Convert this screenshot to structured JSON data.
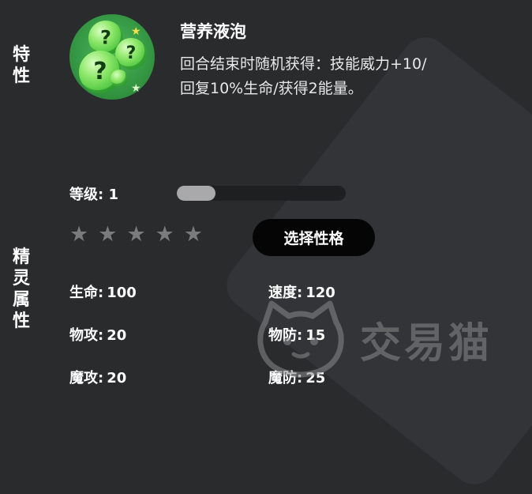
{
  "labels": {
    "trait": "特\n性",
    "attributes": "精\n灵\n属\n性"
  },
  "ability": {
    "icon": "bubble-question-icon",
    "title": "营养液泡",
    "description": "回合结束时随机获得：技能威力+10/\n回复10%生命/获得2能量。"
  },
  "level": {
    "label": "等级:",
    "value": "1",
    "progress": 0.23
  },
  "stars": {
    "total": 5,
    "filled": 0
  },
  "nature_button": "选择性格",
  "stats": {
    "hp": {
      "label": "生命:",
      "value": "100"
    },
    "speed": {
      "label": "速度:",
      "value": "120"
    },
    "attack": {
      "label": "物攻:",
      "value": "20"
    },
    "defense": {
      "label": "物防:",
      "value": "15"
    },
    "sp_attack": {
      "label": "魔攻:",
      "value": "20"
    },
    "sp_defense": {
      "label": "魔防:",
      "value": "25"
    }
  },
  "watermark": {
    "text": "交易猫",
    "icon": "cat-logo-icon"
  },
  "colors": {
    "background": "#2a2b2d",
    "button_bg": "#050505",
    "bar_fill": "#a9a9ab",
    "bar_track": "#1e1f21",
    "star_empty": "#7a7b7d",
    "icon_green": "#46c23c"
  }
}
